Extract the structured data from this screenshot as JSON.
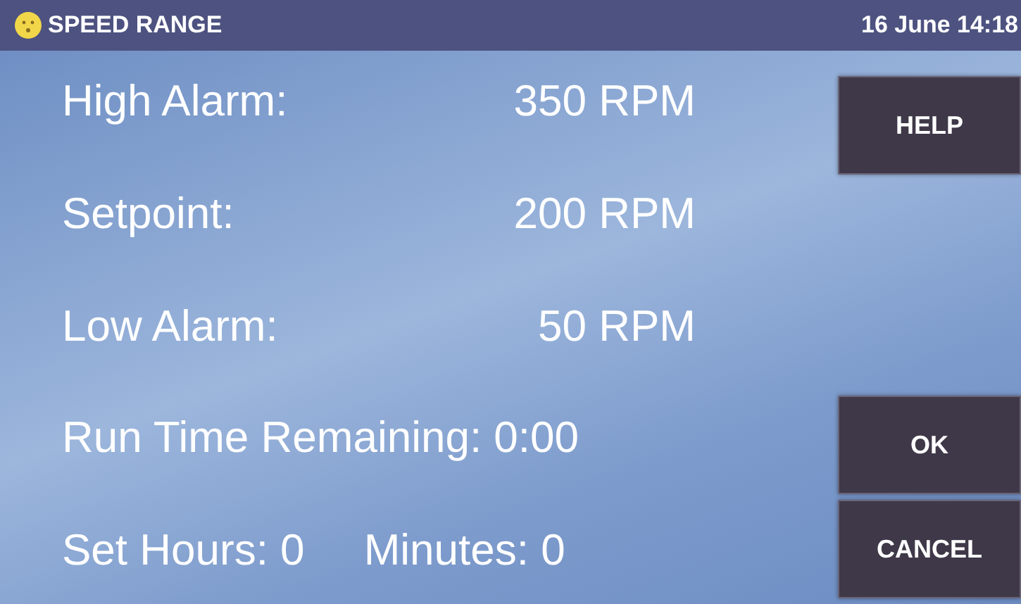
{
  "title_bar": {
    "title": "SPEED RANGE",
    "datetime": "16 June 14:18"
  },
  "readings": [
    {
      "label": "High Alarm:",
      "value": "350 RPM"
    },
    {
      "label": "Setpoint:",
      "value": "200 RPM"
    },
    {
      "label": "Low Alarm:",
      "value": "50 RPM"
    }
  ],
  "run_time": "Run Time Remaining: 0:00",
  "set_time": [
    "Set Hours: 0",
    "Minutes: 0"
  ],
  "buttons": {
    "top": [
      "HELP"
    ],
    "bottom": [
      "OK",
      "CANCEL"
    ]
  }
}
